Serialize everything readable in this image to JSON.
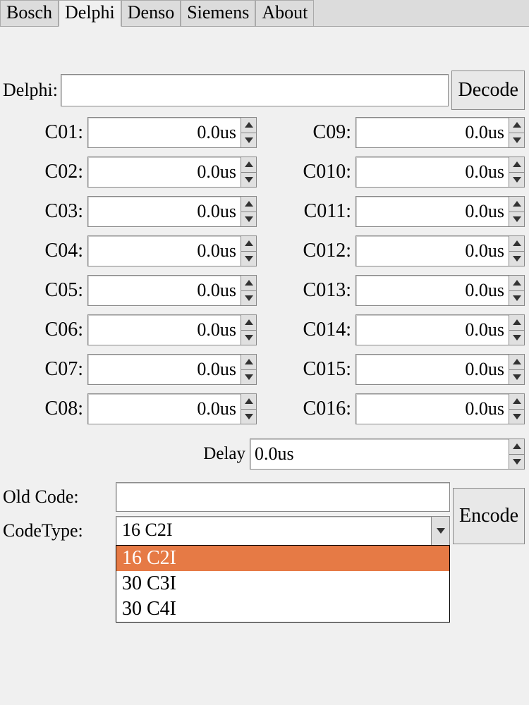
{
  "tabs": [
    "Bosch",
    "Delphi",
    "Denso",
    "Siemens",
    "About"
  ],
  "active_tab": 1,
  "main": {
    "brand_label": "Delphi:",
    "decode_label": "Decode",
    "encode_label": "Encode"
  },
  "fields_left": [
    {
      "label": "C01:",
      "value": "0.0us"
    },
    {
      "label": "C02:",
      "value": "0.0us"
    },
    {
      "label": "C03:",
      "value": "0.0us"
    },
    {
      "label": "C04:",
      "value": "0.0us"
    },
    {
      "label": "C05:",
      "value": "0.0us"
    },
    {
      "label": "C06:",
      "value": "0.0us"
    },
    {
      "label": "C07:",
      "value": "0.0us"
    },
    {
      "label": "C08:",
      "value": "0.0us"
    }
  ],
  "fields_right": [
    {
      "label": "C09:",
      "value": "0.0us"
    },
    {
      "label": "C010:",
      "value": "0.0us"
    },
    {
      "label": "C011:",
      "value": "0.0us"
    },
    {
      "label": "C012:",
      "value": "0.0us"
    },
    {
      "label": "C013:",
      "value": "0.0us"
    },
    {
      "label": "C014:",
      "value": "0.0us"
    },
    {
      "label": "C015:",
      "value": "0.0us"
    },
    {
      "label": "C016:",
      "value": "0.0us"
    }
  ],
  "delay": {
    "label": "Delay",
    "value": "0.0us"
  },
  "old_code": {
    "label": "Old Code:",
    "value": ""
  },
  "code_type": {
    "label": "CodeType:",
    "selected": "16 C2I",
    "options": [
      "16 C2I",
      "30 C3I",
      "30 C4I"
    ],
    "highlighted": 0
  }
}
